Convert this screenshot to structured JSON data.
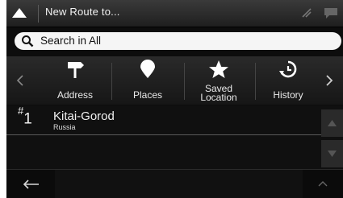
{
  "header": {
    "title": "New Route to..."
  },
  "search": {
    "label": "Search in All"
  },
  "categories": [
    {
      "label": "Address",
      "icon": "signpost-icon"
    },
    {
      "label": "Places",
      "icon": "location-pin-icon"
    },
    {
      "label": "Saved\nLocation",
      "icon": "star-icon"
    },
    {
      "label": "History",
      "icon": "history-clock-icon"
    }
  ],
  "results": [
    {
      "rank_symbol": "#",
      "rank_number": "1",
      "name": "Kitai-Gorod",
      "sub": "Russia"
    }
  ],
  "colors": {
    "background": "#0d0d0d",
    "search_bg": "#f5f5f5",
    "text": "#f0f0f0"
  }
}
